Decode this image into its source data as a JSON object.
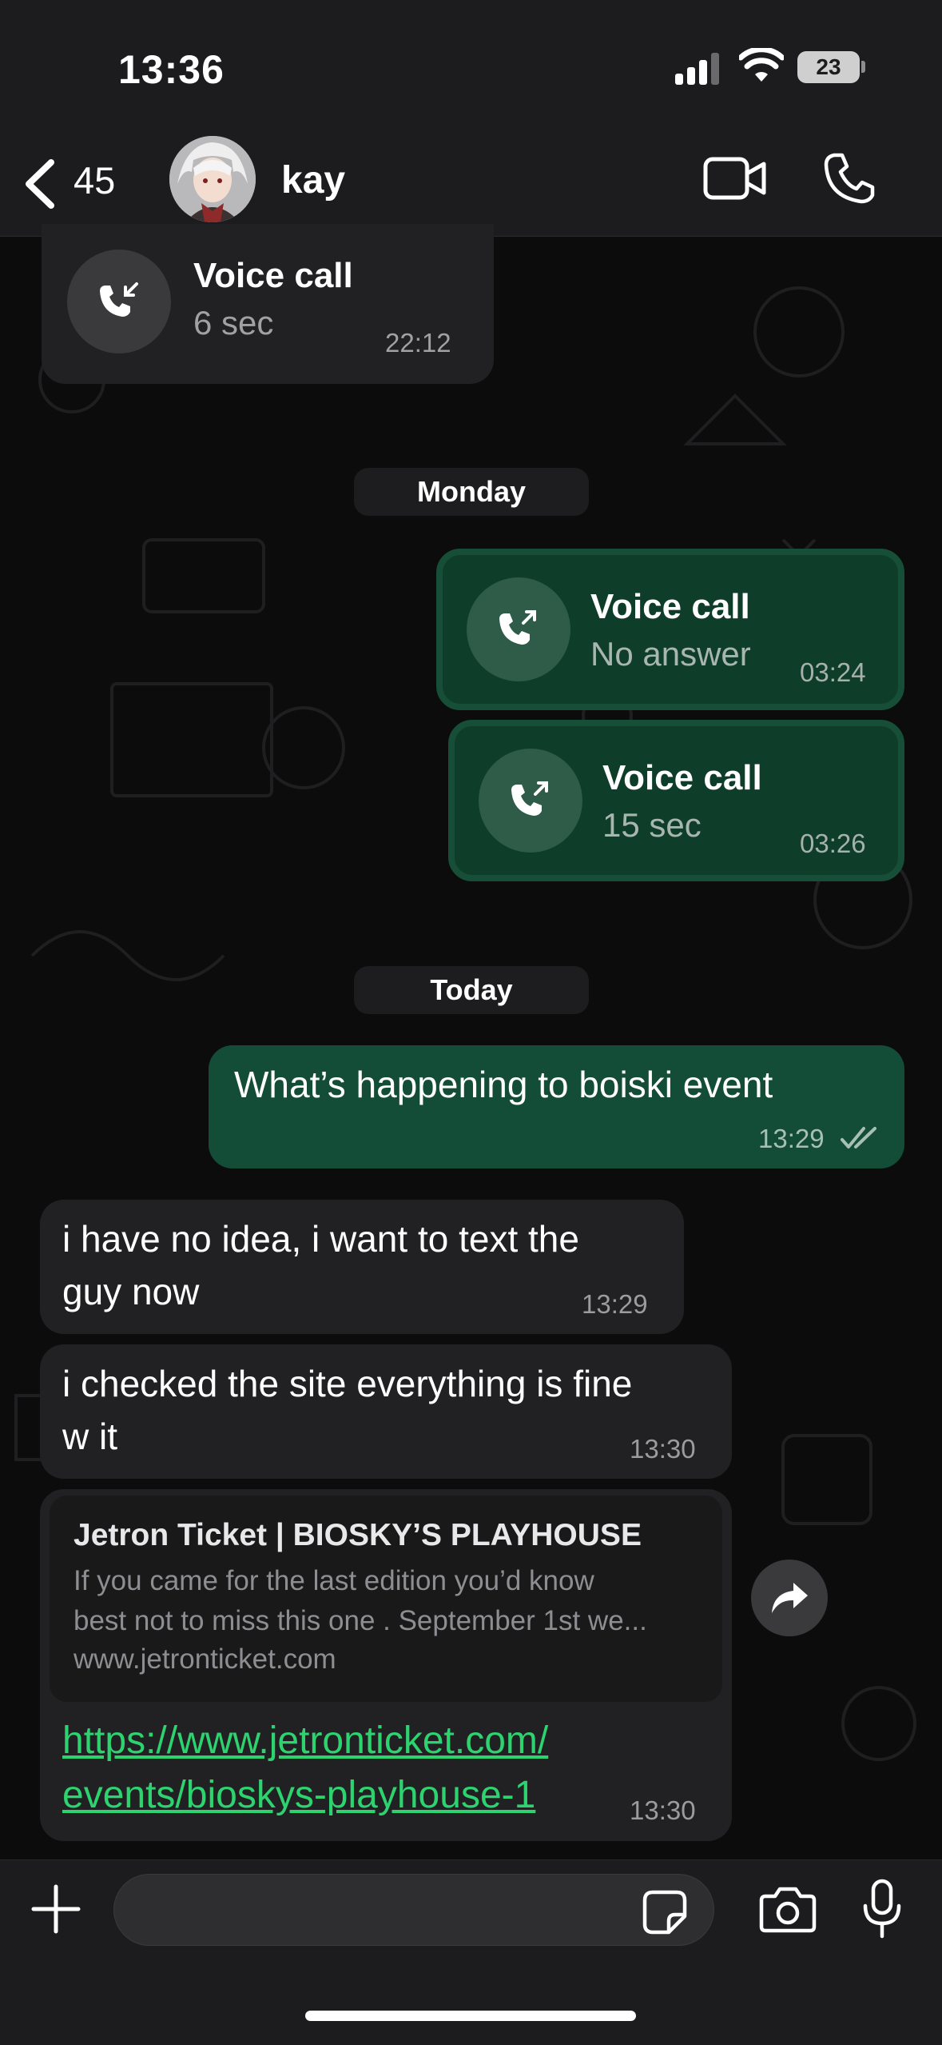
{
  "status": {
    "time": "13:36",
    "battery": "23"
  },
  "header": {
    "back_count": "45",
    "contact_name": "kay"
  },
  "messages": [
    {
      "type": "call",
      "direction": "incoming",
      "title": "Voice call",
      "detail": "6 sec",
      "time": "22:12"
    },
    {
      "type": "day",
      "label": "Monday"
    },
    {
      "type": "call",
      "direction": "outgoing",
      "title": "Voice call",
      "detail": "No answer",
      "time": "03:24"
    },
    {
      "type": "call",
      "direction": "outgoing",
      "title": "Voice call",
      "detail": "15 sec",
      "time": "03:26"
    },
    {
      "type": "day",
      "label": "Today"
    },
    {
      "type": "text",
      "direction": "outgoing",
      "text": "What’s happening to boiski event",
      "time": "13:29",
      "status": "read"
    },
    {
      "type": "text",
      "direction": "incoming",
      "line1": "i have no idea, i want to text the",
      "line2": "guy now",
      "time": "13:29"
    },
    {
      "type": "text",
      "direction": "incoming",
      "line1": "i checked the site everything is fine",
      "line2": "w it",
      "time": "13:30"
    },
    {
      "type": "link",
      "direction": "incoming",
      "preview_title": "Jetron Ticket | BIOSKY’S PLAYHOUSE",
      "preview_line1": "If you came for the last edition  you’d know",
      "preview_line2": "best not to miss this one . September 1st we...",
      "preview_host": "www.jetronticket.com",
      "url_line1": "https://www.jetronticket.com/",
      "url_line2": "events/bioskys-playhouse-1",
      "time": "13:30"
    }
  ],
  "colors": {
    "outgoing": "#144d37",
    "incoming": "#212123",
    "link": "#2dd36f"
  }
}
